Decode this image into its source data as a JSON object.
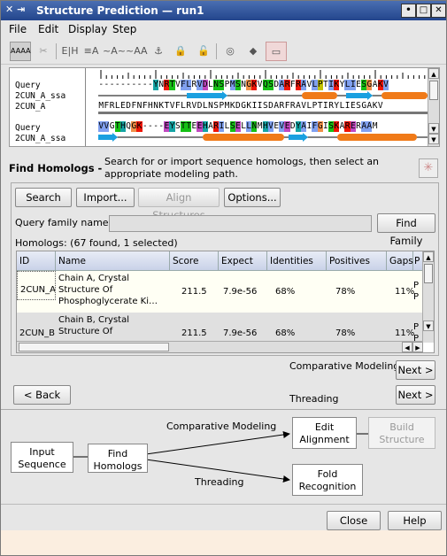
{
  "window": {
    "title": "Structure Prediction — run1",
    "min": "•",
    "max": "□",
    "close": "✕"
  },
  "menu": [
    "File",
    "Edit",
    "Display",
    "Step"
  ],
  "alignment": {
    "labels": [
      "Query",
      "2CUN_A_ssa",
      "2CUN_A",
      "Query",
      "2CUN_A_ssa"
    ],
    "rows": [
      {
        "seq": "----------YNRTVFLRVDLNSPMSNGKVQSDARFRAVLPTIKYLIESGAKV"
      },
      {
        "seq": "MFRLEDFNFHNKTVFLRVDLNSPMKDGKIISDARFRAVLPTIRYLIESGAKV"
      },
      {
        "seq": "VVGTHQGK----EYSTTEEHARILSELLNMHVEVEDYAIFGISKARERAAM"
      }
    ]
  },
  "find_homologs": {
    "title": "Find Homologs  -",
    "description": "Search for or import sequence homologs, then select an appropriate modeling path.",
    "buttons": {
      "search": "Search",
      "import": "Import...",
      "align": "Align Structures",
      "options": "Options..."
    },
    "query_family_label": "Query family name:",
    "query_family_value": "",
    "find_family": "Find Family",
    "summary": "Homologs: (67 found, 1 selected)",
    "columns": [
      "ID",
      "Name",
      "Score",
      "Expect",
      "Identities",
      "Positives",
      "Gaps",
      "P"
    ],
    "rows": [
      {
        "id": "2CUN_A",
        "name": "Chain A, Crystal Structure Of Phosphoglycerate Ki…",
        "score": "211.5",
        "expect": "7.9e-56",
        "identities": "68%",
        "positives": "78%",
        "gaps": "11%",
        "p": "P P"
      },
      {
        "id": "2CUN_B",
        "name": "Chain B, Crystal Structure Of",
        "score": "211.5",
        "expect": "7.9e-56",
        "identities": "68%",
        "positives": "78%",
        "gaps": "11%",
        "p": "P P"
      }
    ]
  },
  "navigation": {
    "comparative_label": "Comparative Modeling",
    "next1": "Next >",
    "back": "< Back",
    "threading_label": "Threading",
    "next2": "Next >"
  },
  "flow": {
    "input": "Input Sequence",
    "find": "Find Homologs",
    "edit": "Edit Alignment",
    "build": "Build Structure",
    "fold": "Fold Recognition",
    "comp_label": "Comparative Modeling",
    "thread_label": "Threading"
  },
  "footer": {
    "close": "Close",
    "help": "Help"
  },
  "colors": {
    "title": "#23458c",
    "strand": "#1aa0e0",
    "helix": "#f07a18"
  }
}
